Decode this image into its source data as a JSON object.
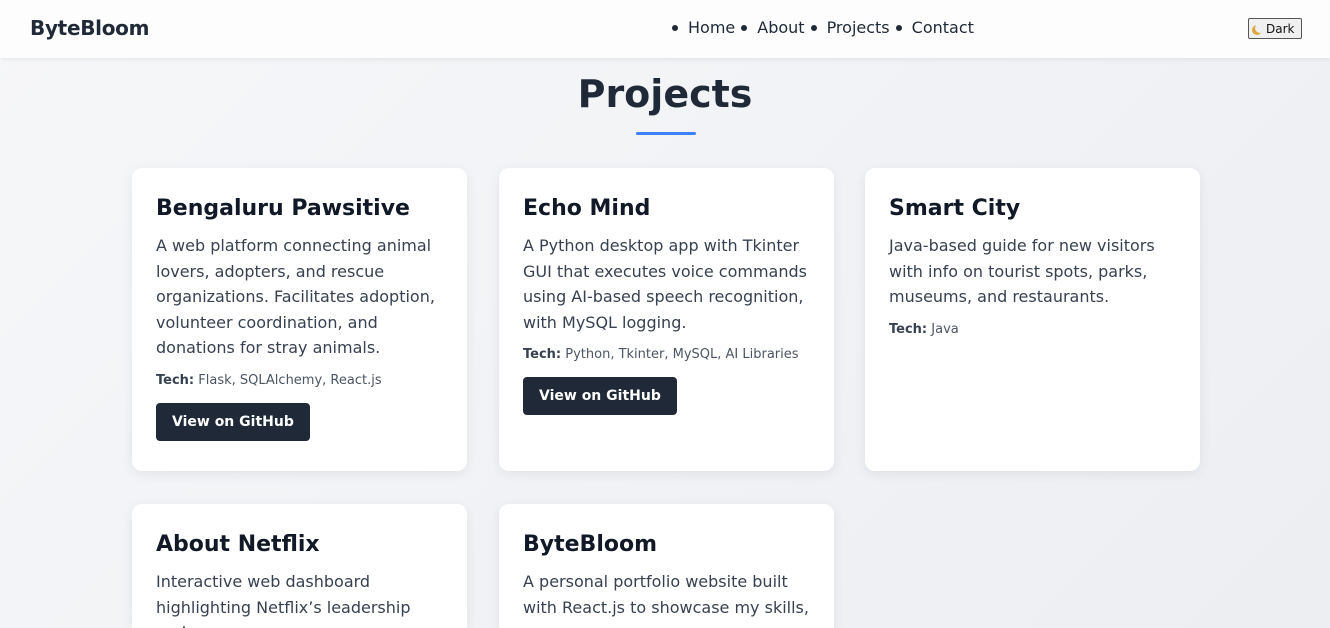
{
  "brand": "ByteBloom",
  "nav": {
    "items": [
      {
        "label": "Home"
      },
      {
        "label": "About"
      },
      {
        "label": "Projects"
      },
      {
        "label": "Contact"
      }
    ]
  },
  "theme_toggle": {
    "icon": "moon-icon",
    "label": "Dark"
  },
  "section": {
    "title": "Projects",
    "accent_color": "#3b82f6"
  },
  "projects": [
    {
      "title": "Bengaluru Pawsitive",
      "description": "A web platform connecting animal lovers, adopters, and rescue organizations. Facilitates adoption, volunteer coordination, and donations for stray animals.",
      "tech_label": "Tech:",
      "tech": "Flask, SQLAlchemy, React.js",
      "button": "View on GitHub"
    },
    {
      "title": "Echo Mind",
      "description": "A Python desktop app with Tkinter GUI that executes voice commands using AI-based speech recognition, with MySQL logging.",
      "tech_label": "Tech:",
      "tech": "Python, Tkinter, MySQL, AI Libraries",
      "button": "View on GitHub"
    },
    {
      "title": "Smart City",
      "description": "Java-based guide for new visitors with info on tourist spots, parks, museums, and restaurants.",
      "tech_label": "Tech:",
      "tech": "Java"
    },
    {
      "title": "About Netflix",
      "description": "Interactive web dashboard highlighting Netflix’s leadership and"
    },
    {
      "title": "ByteBloom",
      "description": "A personal portfolio website built with React.js to showcase my skills,"
    }
  ]
}
